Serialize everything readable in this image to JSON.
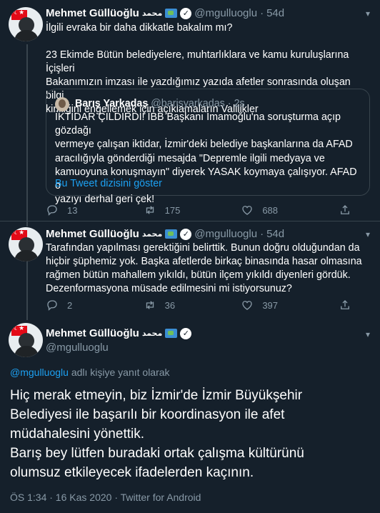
{
  "tweet1": {
    "name": "Mehmet Güllüoğlu",
    "arabic": "محمد",
    "handle": "@mgulluoglu",
    "time": "54d",
    "lines": [
      "İlgili evraka bir daha dikkatle bakalım mı?",
      "",
      "23 Ekimde Bütün belediyelere, muhtarlıklara ve kamu kuruluşlarına İçişleri",
      "Bakanımızın imzası ile yazdığımız yazıda afetler sonrasında oluşan bilgi",
      "kirliliğini engellemek için açıklamaların Valilikler"
    ],
    "quote": {
      "name": "Barış Yarkadaş",
      "handle": "@barisyarkadas",
      "time": "2s",
      "lines": [
        "İKTİDAR ÇILDIRDI! İBB Başkanı İmamoğlu'na soruşturma açıp gözdağı",
        "vermeye çalışan iktidar, İzmir'deki belediye başkanlarına da AFAD",
        "aracılığıyla gönderdiği mesajda \"Depremle ilgili medyaya ve",
        "kamuoyuna konuşmayın\" diyerek YASAK koymaya çalışıyor. AFAD o",
        "yazıyı derhal geri çek!"
      ],
      "thread_link": "Bu Tweet dizisini göster"
    },
    "replies": "13",
    "retweets": "175",
    "likes": "688"
  },
  "tweet2": {
    "name": "Mehmet Güllüoğlu",
    "arabic": "محمد",
    "handle": "@mgulluoglu",
    "time": "54d",
    "lines": [
      "Tarafından yapılması gerektiğini belirttik. Bunun doğru olduğundan da",
      "hiçbir şüphemiz yok. Başka afetlerde birkaç binasında hasar olmasına",
      "rağmen bütün mahallem yıkıldı, bütün ilçem yıkıldı diyenleri gördük.",
      "Dezenformasyona müsade edilmesini mi istiyorsunuz?"
    ],
    "replies": "2",
    "retweets": "36",
    "likes": "397"
  },
  "main_tweet": {
    "name": "Mehmet Güllüoğlu",
    "arabic": "محمد",
    "handle": "@mgulluoglu",
    "reply_mention": "@mgulluoglu",
    "reply_suffix": "adlı kişiye yanıt olarak",
    "lines": [
      "Hiç merak etmeyin, biz İzmir'de İzmir Büyükşehir",
      "Belediyesi ile başarılı bir koordinasyon ile afet",
      "müdahalesini yönettik.",
      "Barış bey lütfen buradaki ortak çalışma kültürünü",
      "olumsuz etkileyecek ifadelerden kaçının."
    ],
    "meta": "ÖS 1:34 · 16 Kas 2020 · Twitter for Android"
  },
  "colors": {
    "background": "#15202b",
    "muted": "#8899a6",
    "link": "#1da1f2",
    "border": "#38444d"
  },
  "icons": [
    "reply-icon",
    "retweet-icon",
    "like-icon",
    "share-icon",
    "verified-icon",
    "chevron-down-icon",
    "map-emoji"
  ]
}
